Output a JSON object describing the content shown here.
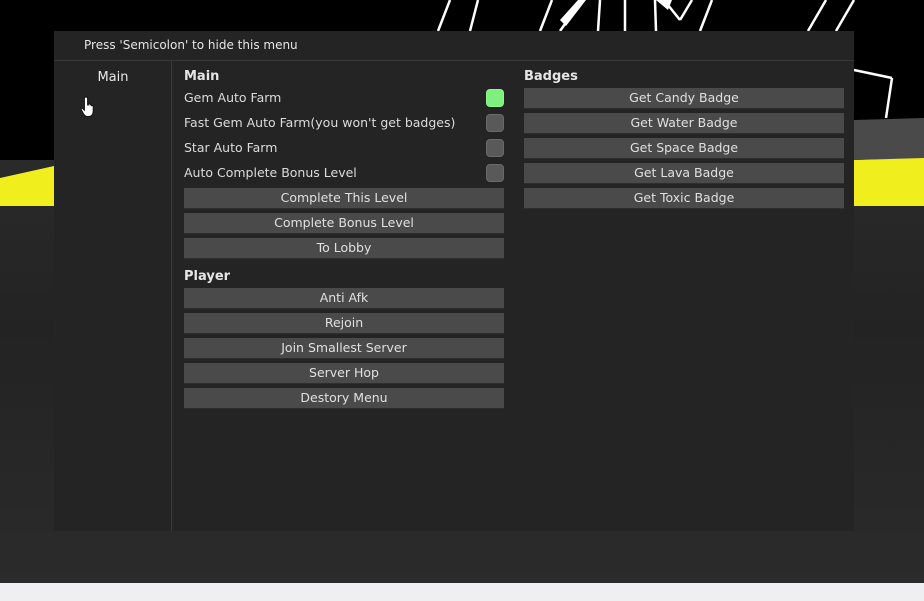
{
  "menu": {
    "header_text": "Press 'Semicolon' to hide this menu",
    "sidebar": {
      "tabs": [
        {
          "label": "Main"
        }
      ]
    },
    "main_section": {
      "title": "Main",
      "toggles": [
        {
          "label": "Gem Auto Farm",
          "enabled": true
        },
        {
          "label": "Fast Gem Auto Farm(you won't get badges)",
          "enabled": false
        },
        {
          "label": "Star Auto Farm",
          "enabled": false
        },
        {
          "label": "Auto Complete Bonus Level",
          "enabled": false
        }
      ],
      "buttons": [
        {
          "label": "Complete This Level"
        },
        {
          "label": "Complete Bonus Level"
        },
        {
          "label": "To Lobby"
        }
      ]
    },
    "player_section": {
      "title": "Player",
      "buttons": [
        {
          "label": "Anti Afk"
        },
        {
          "label": "Rejoin"
        },
        {
          "label": "Join Smallest Server"
        },
        {
          "label": "Server Hop"
        },
        {
          "label": "Destory Menu"
        }
      ]
    },
    "badges_section": {
      "title": "Badges",
      "buttons": [
        {
          "label": "Get Candy Badge"
        },
        {
          "label": "Get Water Badge"
        },
        {
          "label": "Get Space Badge"
        },
        {
          "label": "Get Lava Badge"
        },
        {
          "label": "Get Toxic Badge"
        }
      ]
    }
  },
  "colors": {
    "panel": "#242424",
    "button": "#4a4a4a",
    "toggle_on": "#7ef07e",
    "toggle_off": "#595959",
    "accent_yellow": "#f0ee1c"
  },
  "icons": {
    "cursor": "hand-pointer-icon"
  }
}
